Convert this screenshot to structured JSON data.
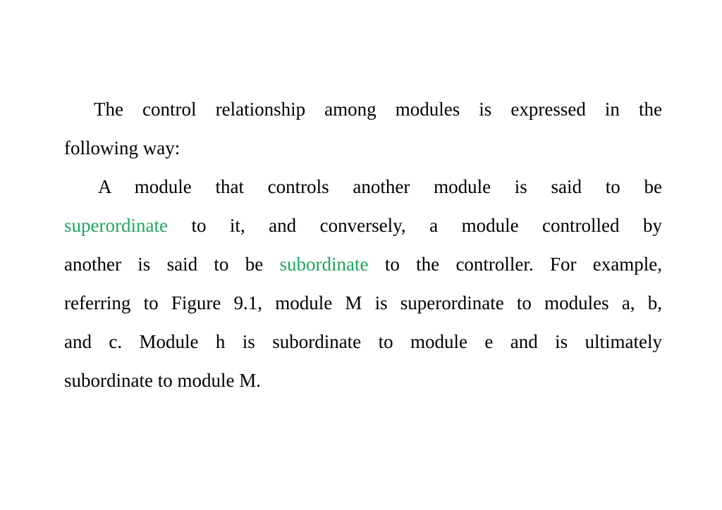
{
  "paragraphs": [
    {
      "lines": [
        {
          "text": "The control relationship among modules is expressed in the"
        },
        {
          "text": "following way:"
        }
      ]
    },
    {
      "lines": [
        {
          "text": "A module that controls another module is said to  be"
        },
        {
          "pre": "",
          "highlight": "superordinate",
          "post": " to it, and conversely, a module controlled by"
        },
        {
          "pre": "another is said to be ",
          "highlight": "subordinate",
          "post": " to the controller. For example,"
        },
        {
          "text": "referring to Figure 9.1, module M is superordinate to modules a, b,"
        },
        {
          "text": "and c. Module h is subordinate to module e and is ultimately"
        },
        {
          "text": "subordinate to module M."
        }
      ]
    }
  ],
  "colors": {
    "highlight": "#1aa85a",
    "text": "#000000",
    "background": "#ffffff"
  }
}
